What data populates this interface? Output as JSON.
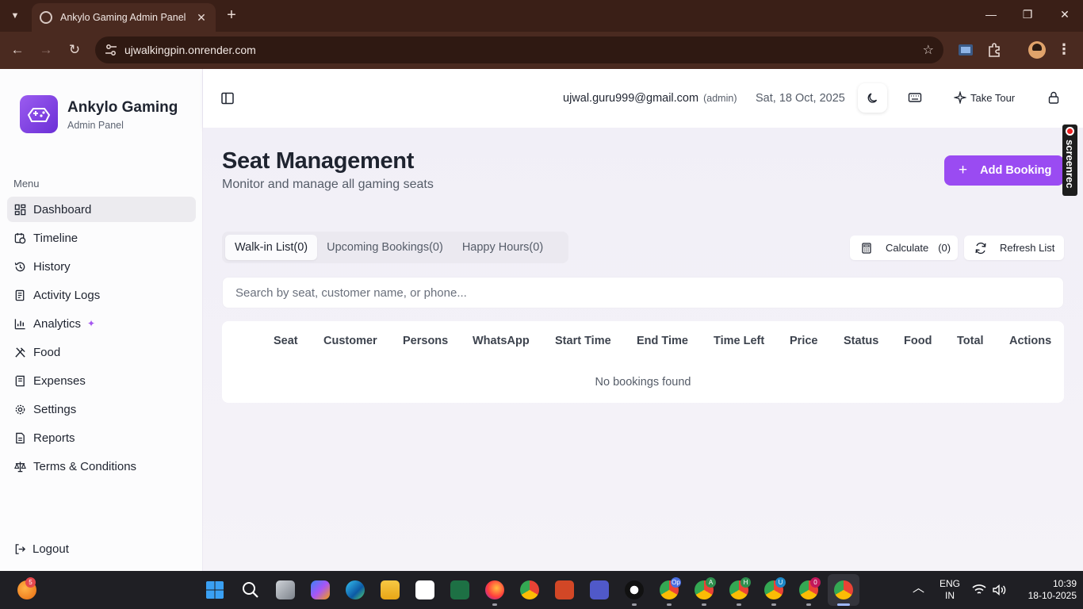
{
  "browser": {
    "tab_title": "Ankylo Gaming Admin Panel",
    "url": "ujwalkingpin.onrender.com"
  },
  "sidebar": {
    "brand_name": "Ankylo Gaming",
    "brand_sub": "Admin Panel",
    "menu_label": "Menu",
    "items": [
      {
        "label": "Dashboard",
        "icon": "grid-icon"
      },
      {
        "label": "Timeline",
        "icon": "calendar-clock-icon"
      },
      {
        "label": "History",
        "icon": "history-icon"
      },
      {
        "label": "Activity Logs",
        "icon": "logs-icon"
      },
      {
        "label": "Analytics",
        "icon": "bar-chart-icon"
      },
      {
        "label": "Food",
        "icon": "utensils-icon"
      },
      {
        "label": "Expenses",
        "icon": "receipt-icon"
      },
      {
        "label": "Settings",
        "icon": "gear-icon"
      },
      {
        "label": "Reports",
        "icon": "document-icon"
      },
      {
        "label": "Terms & Conditions",
        "icon": "scale-icon"
      }
    ],
    "logout_label": "Logout"
  },
  "header": {
    "email": "ujwal.guru999@gmail.com",
    "role": "(admin)",
    "date": "Sat, 18 Oct, 2025",
    "tour_label": "Take Tour"
  },
  "page": {
    "title": "Seat Management",
    "subtitle": "Monitor and manage all gaming seats",
    "add_booking_label": "Add Booking",
    "tabs": [
      {
        "label": "Walk-in List(0)",
        "active": true
      },
      {
        "label": "Upcoming Bookings(0)",
        "active": false
      },
      {
        "label": "Happy Hours(0)",
        "active": false
      }
    ],
    "calculate_label": "Calculate",
    "calculate_count": "(0)",
    "refresh_label": "Refresh List",
    "search_placeholder": "Search by seat, customer name, or phone...",
    "table": {
      "columns": [
        "Seat",
        "Customer",
        "Persons",
        "WhatsApp",
        "Start Time",
        "End Time",
        "Time Left",
        "Price",
        "Status",
        "Food",
        "Total",
        "Actions"
      ],
      "empty_text": "No bookings found"
    }
  },
  "screenrec_label": "screenrec",
  "taskbar": {
    "weather_badge": "5",
    "lang_line1": "ENG",
    "lang_line2": "IN",
    "time": "10:39",
    "date": "18-10-2025",
    "badges": [
      "Op",
      "A",
      "H",
      "U",
      "0"
    ]
  },
  "colors": {
    "accent": "#9a4bf2",
    "browser_frame": "#3a1f17",
    "taskbar": "#1f1f24"
  }
}
